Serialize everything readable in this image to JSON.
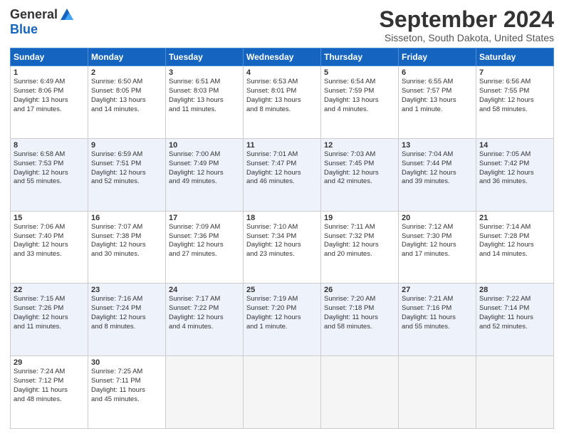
{
  "header": {
    "logo_general": "General",
    "logo_blue": "Blue",
    "month": "September 2024",
    "location": "Sisseton, South Dakota, United States"
  },
  "weekdays": [
    "Sunday",
    "Monday",
    "Tuesday",
    "Wednesday",
    "Thursday",
    "Friday",
    "Saturday"
  ],
  "weeks": [
    [
      {
        "day": 1,
        "lines": [
          "Sunrise: 6:49 AM",
          "Sunset: 8:06 PM",
          "Daylight: 13 hours",
          "and 17 minutes."
        ]
      },
      {
        "day": 2,
        "lines": [
          "Sunrise: 6:50 AM",
          "Sunset: 8:05 PM",
          "Daylight: 13 hours",
          "and 14 minutes."
        ]
      },
      {
        "day": 3,
        "lines": [
          "Sunrise: 6:51 AM",
          "Sunset: 8:03 PM",
          "Daylight: 13 hours",
          "and 11 minutes."
        ]
      },
      {
        "day": 4,
        "lines": [
          "Sunrise: 6:53 AM",
          "Sunset: 8:01 PM",
          "Daylight: 13 hours",
          "and 8 minutes."
        ]
      },
      {
        "day": 5,
        "lines": [
          "Sunrise: 6:54 AM",
          "Sunset: 7:59 PM",
          "Daylight: 13 hours",
          "and 4 minutes."
        ]
      },
      {
        "day": 6,
        "lines": [
          "Sunrise: 6:55 AM",
          "Sunset: 7:57 PM",
          "Daylight: 13 hours",
          "and 1 minute."
        ]
      },
      {
        "day": 7,
        "lines": [
          "Sunrise: 6:56 AM",
          "Sunset: 7:55 PM",
          "Daylight: 12 hours",
          "and 58 minutes."
        ]
      }
    ],
    [
      {
        "day": 8,
        "lines": [
          "Sunrise: 6:58 AM",
          "Sunset: 7:53 PM",
          "Daylight: 12 hours",
          "and 55 minutes."
        ]
      },
      {
        "day": 9,
        "lines": [
          "Sunrise: 6:59 AM",
          "Sunset: 7:51 PM",
          "Daylight: 12 hours",
          "and 52 minutes."
        ]
      },
      {
        "day": 10,
        "lines": [
          "Sunrise: 7:00 AM",
          "Sunset: 7:49 PM",
          "Daylight: 12 hours",
          "and 49 minutes."
        ]
      },
      {
        "day": 11,
        "lines": [
          "Sunrise: 7:01 AM",
          "Sunset: 7:47 PM",
          "Daylight: 12 hours",
          "and 46 minutes."
        ]
      },
      {
        "day": 12,
        "lines": [
          "Sunrise: 7:03 AM",
          "Sunset: 7:45 PM",
          "Daylight: 12 hours",
          "and 42 minutes."
        ]
      },
      {
        "day": 13,
        "lines": [
          "Sunrise: 7:04 AM",
          "Sunset: 7:44 PM",
          "Daylight: 12 hours",
          "and 39 minutes."
        ]
      },
      {
        "day": 14,
        "lines": [
          "Sunrise: 7:05 AM",
          "Sunset: 7:42 PM",
          "Daylight: 12 hours",
          "and 36 minutes."
        ]
      }
    ],
    [
      {
        "day": 15,
        "lines": [
          "Sunrise: 7:06 AM",
          "Sunset: 7:40 PM",
          "Daylight: 12 hours",
          "and 33 minutes."
        ]
      },
      {
        "day": 16,
        "lines": [
          "Sunrise: 7:07 AM",
          "Sunset: 7:38 PM",
          "Daylight: 12 hours",
          "and 30 minutes."
        ]
      },
      {
        "day": 17,
        "lines": [
          "Sunrise: 7:09 AM",
          "Sunset: 7:36 PM",
          "Daylight: 12 hours",
          "and 27 minutes."
        ]
      },
      {
        "day": 18,
        "lines": [
          "Sunrise: 7:10 AM",
          "Sunset: 7:34 PM",
          "Daylight: 12 hours",
          "and 23 minutes."
        ]
      },
      {
        "day": 19,
        "lines": [
          "Sunrise: 7:11 AM",
          "Sunset: 7:32 PM",
          "Daylight: 12 hours",
          "and 20 minutes."
        ]
      },
      {
        "day": 20,
        "lines": [
          "Sunrise: 7:12 AM",
          "Sunset: 7:30 PM",
          "Daylight: 12 hours",
          "and 17 minutes."
        ]
      },
      {
        "day": 21,
        "lines": [
          "Sunrise: 7:14 AM",
          "Sunset: 7:28 PM",
          "Daylight: 12 hours",
          "and 14 minutes."
        ]
      }
    ],
    [
      {
        "day": 22,
        "lines": [
          "Sunrise: 7:15 AM",
          "Sunset: 7:26 PM",
          "Daylight: 12 hours",
          "and 11 minutes."
        ]
      },
      {
        "day": 23,
        "lines": [
          "Sunrise: 7:16 AM",
          "Sunset: 7:24 PM",
          "Daylight: 12 hours",
          "and 8 minutes."
        ]
      },
      {
        "day": 24,
        "lines": [
          "Sunrise: 7:17 AM",
          "Sunset: 7:22 PM",
          "Daylight: 12 hours",
          "and 4 minutes."
        ]
      },
      {
        "day": 25,
        "lines": [
          "Sunrise: 7:19 AM",
          "Sunset: 7:20 PM",
          "Daylight: 12 hours",
          "and 1 minute."
        ]
      },
      {
        "day": 26,
        "lines": [
          "Sunrise: 7:20 AM",
          "Sunset: 7:18 PM",
          "Daylight: 11 hours",
          "and 58 minutes."
        ]
      },
      {
        "day": 27,
        "lines": [
          "Sunrise: 7:21 AM",
          "Sunset: 7:16 PM",
          "Daylight: 11 hours",
          "and 55 minutes."
        ]
      },
      {
        "day": 28,
        "lines": [
          "Sunrise: 7:22 AM",
          "Sunset: 7:14 PM",
          "Daylight: 11 hours",
          "and 52 minutes."
        ]
      }
    ],
    [
      {
        "day": 29,
        "lines": [
          "Sunrise: 7:24 AM",
          "Sunset: 7:12 PM",
          "Daylight: 11 hours",
          "and 48 minutes."
        ]
      },
      {
        "day": 30,
        "lines": [
          "Sunrise: 7:25 AM",
          "Sunset: 7:11 PM",
          "Daylight: 11 hours",
          "and 45 minutes."
        ]
      },
      {
        "day": null,
        "lines": []
      },
      {
        "day": null,
        "lines": []
      },
      {
        "day": null,
        "lines": []
      },
      {
        "day": null,
        "lines": []
      },
      {
        "day": null,
        "lines": []
      }
    ]
  ]
}
